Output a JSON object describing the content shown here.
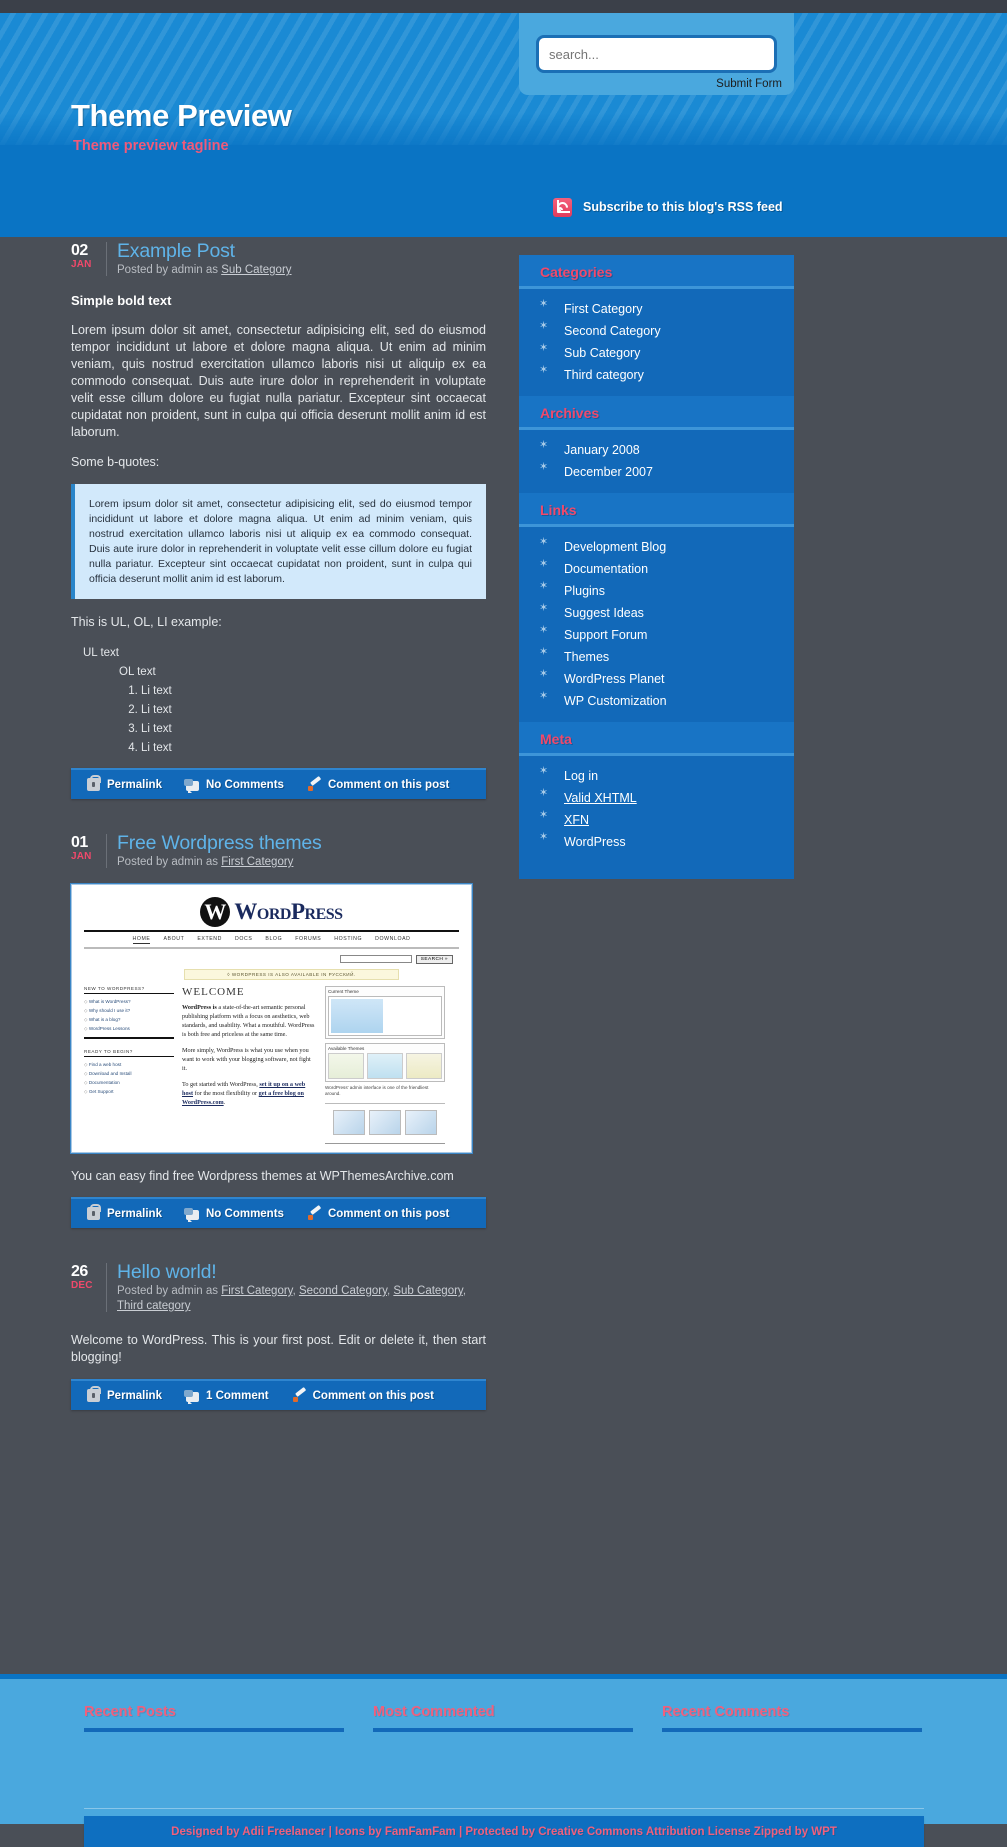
{
  "header": {
    "blog_title": "Theme Preview",
    "tagline": "Theme preview tagline",
    "search": {
      "placeholder": "search...",
      "value": "",
      "submit_label": "Submit Form"
    },
    "rss": {
      "label": "Subscribe to this blog's RSS feed",
      "icon": "rss-icon"
    }
  },
  "colors": {
    "header_blue": "#0a74c4",
    "stripe_blue": "#1a8ad4",
    "page_bg": "#4a4f57",
    "accent_pink": "#f0496b",
    "link_blue": "#5fb3e8",
    "sidebar_blue": "#1269b9",
    "footer_blue": "#4aa8de"
  },
  "posts": [
    {
      "day": "02",
      "month": "JAN",
      "title": "Example Post",
      "meta_prefix": "Posted by admin as ",
      "categories": [
        "Sub Category"
      ],
      "subheading": "Simple bold text",
      "paragraph": "Lorem ipsum dolor sit amet, consectetur adipisicing elit, sed do eiusmod tempor incididunt ut labore et dolore magna aliqua. Ut enim ad minim veniam, quis nostrud exercitation ullamco laboris nisi ut aliquip ex ea commodo consequat. Duis aute irure dolor in reprehenderit in voluptate velit esse cillum dolore eu fugiat nulla pariatur. Excepteur sint occaecat cupidatat non proident, sunt in culpa qui officia deserunt mollit anim id est laborum.",
      "bquote_intro": "Some b-quotes:",
      "blockquote": "Lorem ipsum dolor sit amet, consectetur adipisicing elit, sed do eiusmod tempor incididunt ut labore et dolore magna aliqua. Ut enim ad minim veniam, quis nostrud exercitation ullamco laboris nisi ut aliquip ex ea commodo consequat. Duis aute irure dolor in reprehenderit in voluptate velit esse cillum dolore eu fugiat nulla pariatur. Excepteur sint occaecat cupidatat non proident, sunt in culpa qui officia deserunt mollit anim id est laborum.",
      "list_intro": "This is UL, OL, LI example:",
      "ul_text": "UL text",
      "ol_text": "OL text",
      "li_items": [
        "Li text",
        "Li text",
        "Li text",
        "Li text"
      ],
      "permalink": {
        "permalink_label": "Permalink",
        "comments_label": "No Comments",
        "comment_on_label": "Comment on this post"
      }
    },
    {
      "day": "01",
      "month": "JAN",
      "title": "Free Wordpress themes",
      "meta_prefix": "Posted by admin as ",
      "categories": [
        "First Category"
      ],
      "caption": "You can easy find free Wordpress themes at WPThemesArchive.com",
      "permalink": {
        "permalink_label": "Permalink",
        "comments_label": "No Comments",
        "comment_on_label": "Comment on this post"
      }
    },
    {
      "day": "26",
      "month": "DEC",
      "title": "Hello world!",
      "meta_prefix": "Posted by admin as ",
      "categories": [
        "First Category",
        "Second Category",
        "Sub Category",
        "Third category"
      ],
      "body": "Welcome to WordPress. This is your first post. Edit or delete it, then start blogging!",
      "permalink": {
        "permalink_label": "Permalink",
        "comments_label": "1 Comment",
        "comment_on_label": "Comment on this post"
      }
    }
  ],
  "wp_screenshot": {
    "wordmark": "WordPress",
    "logo_letter": "W",
    "nav": [
      "HOME",
      "ABOUT",
      "EXTEND",
      "DOCS",
      "BLOG",
      "FORUMS",
      "HOSTING",
      "DOWNLOAD"
    ],
    "search_button": "SEARCH »",
    "notice": "◊ WORDPRESS IS ALSO AVAILABLE IN РУССКИЙ.",
    "left_heading_1": "NEW TO WORDPRESS?",
    "left_items_1": [
      "What is WordPress?",
      "Why should I use it?",
      "What is a blog?",
      "WordPress Lessons"
    ],
    "left_heading_2": "READY TO BEGIN?",
    "left_items_2": [
      "Find a web host",
      "Download and Install",
      "Documentation",
      "Get Support"
    ],
    "welcome": "WELCOME",
    "para1_bold": "WordPress is",
    "para1": " a state-of-the-art semantic personal publishing platform with a focus on aesthetics, web standards, and usability. What a mouthful. WordPress is both free and priceless at the same time.",
    "para2": "More simply, WordPress is what you use when you want to work with your blogging software, not fight it.",
    "para3_a": "To get started with WordPress, ",
    "para3_link1": "set it up on a web host",
    "para3_b": " for the most flexibility or ",
    "para3_link2": "get a free blog on WordPress.com",
    "para3_c": ".",
    "panel1_title": "Current Theme",
    "panel2_title": "Available Themes",
    "panel_caption": "WordPress' admin interface is one of the friendliest around."
  },
  "sidebar": {
    "widgets": [
      {
        "title": "Categories",
        "items": [
          {
            "label": "First Category",
            "underlined": false
          },
          {
            "label": "Second Category",
            "underlined": false
          },
          {
            "label": "Sub Category",
            "underlined": false
          },
          {
            "label": "Third category",
            "underlined": false
          }
        ]
      },
      {
        "title": "Archives",
        "items": [
          {
            "label": "January 2008",
            "underlined": false
          },
          {
            "label": "December 2007",
            "underlined": false
          }
        ]
      },
      {
        "title": "Links",
        "items": [
          {
            "label": "Development Blog",
            "underlined": false
          },
          {
            "label": "Documentation",
            "underlined": false
          },
          {
            "label": "Plugins",
            "underlined": false
          },
          {
            "label": "Suggest Ideas",
            "underlined": false
          },
          {
            "label": "Support Forum",
            "underlined": false
          },
          {
            "label": "Themes",
            "underlined": false
          },
          {
            "label": "WordPress Planet",
            "underlined": false
          },
          {
            "label": "WP Customization",
            "underlined": false
          }
        ]
      },
      {
        "title": "Meta",
        "items": [
          {
            "label": "Log in",
            "underlined": false
          },
          {
            "label": "Valid XHTML",
            "underlined": true
          },
          {
            "label": "XFN",
            "underlined": true
          },
          {
            "label": "WordPress",
            "underlined": false
          }
        ]
      }
    ]
  },
  "footer": {
    "columns": [
      {
        "title": "Recent Posts"
      },
      {
        "title": "Most Commented"
      },
      {
        "title": "Recent Comments"
      }
    ],
    "credit": "Designed by Adii Freelancer  |  Icons by FamFamFam  |  Protected by Creative Commons Attribution License Zipped by WPT"
  }
}
